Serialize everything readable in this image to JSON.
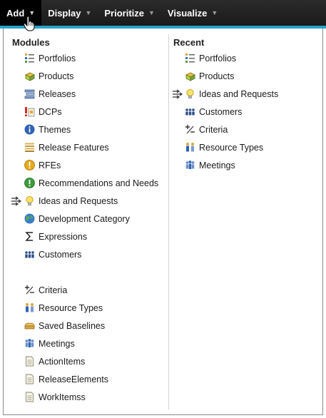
{
  "menubar": {
    "items": [
      {
        "label": "Add"
      },
      {
        "label": "Display"
      },
      {
        "label": "Prioritize"
      },
      {
        "label": "Visualize"
      }
    ]
  },
  "modules": {
    "heading": "Modules",
    "items": [
      {
        "label": "Portfolios",
        "icon": "portfolio-icon"
      },
      {
        "label": "Products",
        "icon": "product-icon"
      },
      {
        "label": "Releases",
        "icon": "release-icon"
      },
      {
        "label": "DCPs",
        "icon": "dcp-icon"
      },
      {
        "label": "Themes",
        "icon": "info-icon"
      },
      {
        "label": "Release Features",
        "icon": "feature-stack-icon"
      },
      {
        "label": "RFEs",
        "icon": "warning-circle-icon"
      },
      {
        "label": "Recommendations and Needs",
        "icon": "exclamation-circle-icon"
      },
      {
        "label": "Ideas and Requests",
        "icon": "lightbulb-icon"
      },
      {
        "label": "Development Category",
        "icon": "globe-icon"
      },
      {
        "label": "Expressions",
        "icon": "sigma-icon"
      },
      {
        "label": "Customers",
        "icon": "customers-icon"
      },
      {
        "label": "Criteria",
        "icon": "criteria-icon"
      },
      {
        "label": "Resource Types",
        "icon": "resource-types-icon"
      },
      {
        "label": "Saved Baselines",
        "icon": "baseline-icon"
      },
      {
        "label": "Meetings",
        "icon": "meetings-icon"
      },
      {
        "label": "ActionItems",
        "icon": "document-icon"
      },
      {
        "label": "ReleaseElements",
        "icon": "document-icon"
      },
      {
        "label": "WorkItemss",
        "icon": "document-icon"
      }
    ]
  },
  "recent": {
    "heading": "Recent",
    "items": [
      {
        "label": "Portfolios",
        "icon": "portfolio-icon"
      },
      {
        "label": "Products",
        "icon": "product-icon"
      },
      {
        "label": "Ideas and Requests",
        "icon": "lightbulb-icon"
      },
      {
        "label": "Customers",
        "icon": "customers-icon"
      },
      {
        "label": "Criteria",
        "icon": "criteria-icon"
      },
      {
        "label": "Resource Types",
        "icon": "resource-types-icon"
      },
      {
        "label": "Meetings",
        "icon": "meetings-icon"
      }
    ]
  }
}
